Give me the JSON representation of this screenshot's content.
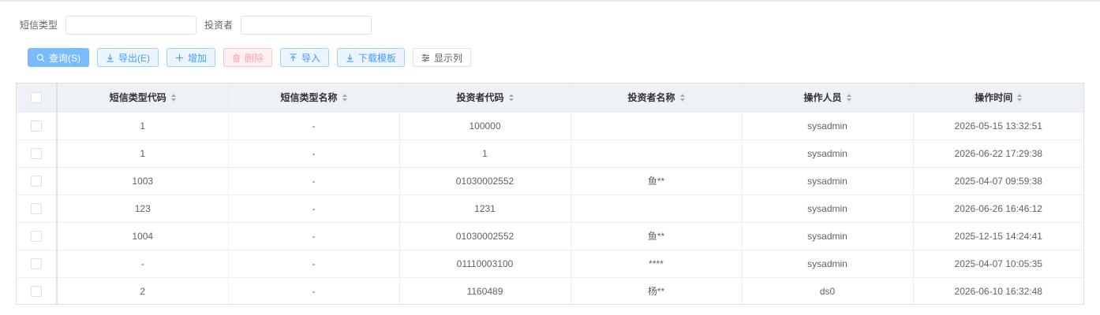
{
  "filters": {
    "sms_type_label": "短信类型",
    "sms_type_value": "",
    "investor_label": "投资者",
    "investor_value": ""
  },
  "toolbar": {
    "query_label": "查询(S)",
    "export_label": "导出(E)",
    "add_label": "增加",
    "delete_label": "删除",
    "import_label": "导入",
    "download_template_label": "下载模板",
    "show_columns_label": "显示列"
  },
  "icons": {
    "query": "search-icon",
    "export": "download-icon",
    "add": "plus-icon",
    "delete": "trash-icon",
    "import": "upload-icon",
    "download_template": "download-icon",
    "show_columns": "columns-icon"
  },
  "colors": {
    "primary": "#409eff",
    "primary_light": "#79bbff",
    "danger_light": "#f9a7a7",
    "header_bg": "#eef1f6"
  },
  "table": {
    "columns": [
      "短信类型代码",
      "短信类型名称",
      "投资者代码",
      "投资者名称",
      "操作人员",
      "操作时间"
    ],
    "rows": [
      [
        "1",
        "-",
        "100000",
        "",
        "sysadmin",
        "2026-05-15 13:32:51"
      ],
      [
        "1",
        "-",
        "1",
        "",
        "sysadmin",
        "2026-06-22 17:29:38"
      ],
      [
        "1003",
        "-",
        "01030002552",
        "鱼**",
        "sysadmin",
        "2025-04-07 09:59:38"
      ],
      [
        "123",
        "-",
        "1231",
        "",
        "sysadmin",
        "2026-06-26 16:46:12"
      ],
      [
        "1004",
        "-",
        "01030002552",
        "鱼**",
        "sysadmin",
        "2025-12-15 14:24:41"
      ],
      [
        "-",
        "-",
        "01110003100",
        "****",
        "sysadmin",
        "2025-04-07 10:05:35"
      ],
      [
        "2",
        "-",
        "1160489",
        "杨**",
        "ds0",
        "2026-06-10 16:32:48"
      ]
    ]
  }
}
